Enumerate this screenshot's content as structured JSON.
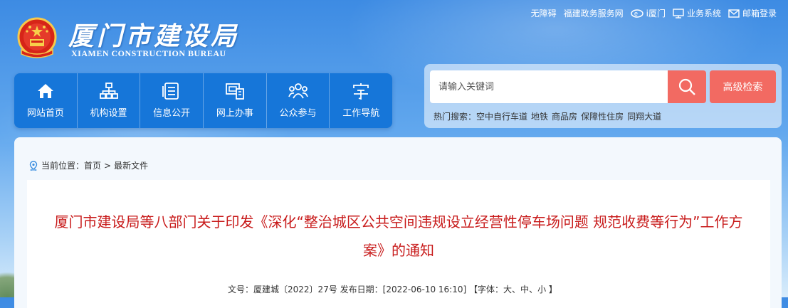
{
  "top_links": {
    "accessibility": "无障碍",
    "fujian_service": "福建政务服务网",
    "ixiamen": "i厦门",
    "business": "业务系统",
    "mail": "邮箱登录"
  },
  "logo": {
    "cn": "厦门市建设局",
    "en": "XIAMEN CONSTRUCTION BUREAU"
  },
  "nav": {
    "items": [
      {
        "label": "网站首页",
        "icon": "home-icon"
      },
      {
        "label": "机构设置",
        "icon": "org-icon"
      },
      {
        "label": "信息公开",
        "icon": "info-icon"
      },
      {
        "label": "网上办事",
        "icon": "online-service-icon"
      },
      {
        "label": "公众参与",
        "icon": "people-icon"
      },
      {
        "label": "工作导航",
        "icon": "guide-icon"
      }
    ]
  },
  "search": {
    "placeholder": "请输入关键词",
    "advanced_label": "高级检索",
    "hot_label": "热门搜索：",
    "hot_keywords": [
      "空中自行车道",
      "地铁",
      "商品房",
      "保障性住房",
      "同翔大道"
    ]
  },
  "breadcrumb": {
    "label": "当前位置：",
    "home": "首页",
    "sep": ">",
    "current": "最新文件"
  },
  "article": {
    "title": "厦门市建设局等八部门关于印发《深化“整治城区公共空间违规设立经营性停车场问题 规范收费等行为”工作方案》的通知",
    "doc_no_label": "文号：",
    "doc_no": "厦建城〔2022〕27号",
    "date_label": "发布日期：",
    "date": "[2022-06-10 16:10]",
    "font_open": "【字体：",
    "font_large": "大",
    "font_medium": "中",
    "font_small": "小",
    "font_sep": "、",
    "font_close": "】"
  },
  "colors": {
    "nav_bg": "#1676d9",
    "accent_red": "#f26a62",
    "title_red": "#c81b1b"
  }
}
